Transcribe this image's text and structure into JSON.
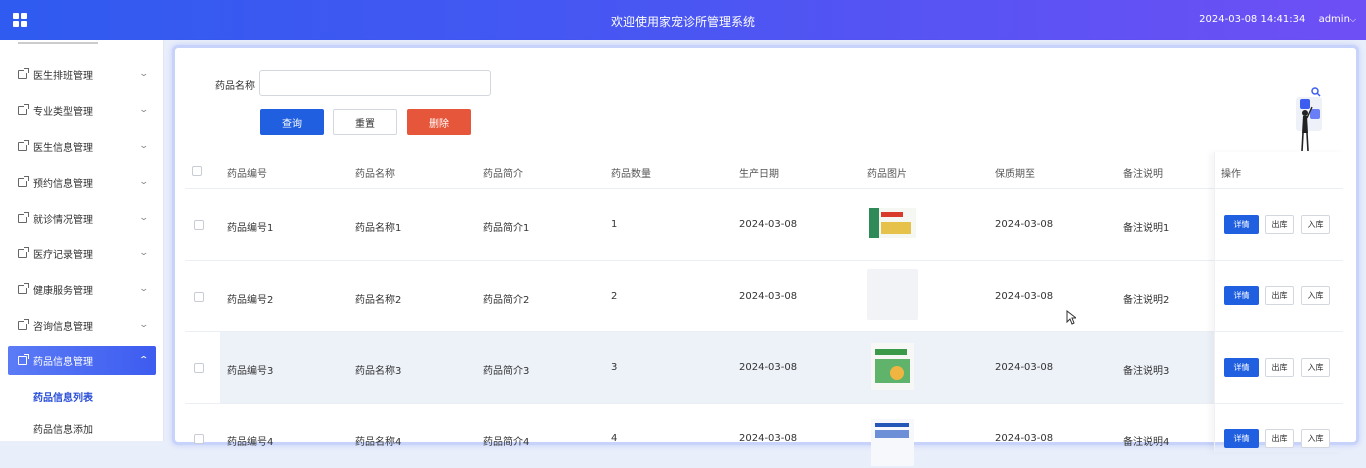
{
  "header": {
    "title": "欢迎使用家宠诊所管理系统",
    "datetime": "2024-03-08 14:41:34",
    "user": "admin",
    "user_caret": "⌵",
    "menu_icon": "grid-icon"
  },
  "sidebar": {
    "items": [
      {
        "label": "医生排班管理"
      },
      {
        "label": "专业类型管理"
      },
      {
        "label": "医生信息管理"
      },
      {
        "label": "预约信息管理"
      },
      {
        "label": "就诊情况管理"
      },
      {
        "label": "医疗记录管理"
      },
      {
        "label": "健康服务管理"
      },
      {
        "label": "咨询信息管理"
      },
      {
        "label": "药品信息管理"
      }
    ],
    "sub_items": [
      {
        "label": "药品信息列表"
      },
      {
        "label": "药品信息添加"
      }
    ]
  },
  "search": {
    "label": "药品名称",
    "value": "",
    "placeholder": ""
  },
  "buttons": {
    "query": "查询",
    "reset": "重置",
    "delete": "删除"
  },
  "table": {
    "columns": [
      "药品编号",
      "药品名称",
      "药品简介",
      "药品数量",
      "生产日期",
      "药品图片",
      "保质期至",
      "备注说明",
      "操作"
    ],
    "rows": [
      {
        "code": "药品编号1",
        "name": "药品名称1",
        "intro": "药品简介1",
        "qty": "1",
        "produced": "2024-03-08",
        "expires": "2024-03-08",
        "remark": "备注说明1"
      },
      {
        "code": "药品编号2",
        "name": "药品名称2",
        "intro": "药品简介2",
        "qty": "2",
        "produced": "2024-03-08",
        "expires": "2024-03-08",
        "remark": "备注说明2"
      },
      {
        "code": "药品编号3",
        "name": "药品名称3",
        "intro": "药品简介3",
        "qty": "3",
        "produced": "2024-03-08",
        "expires": "2024-03-08",
        "remark": "备注说明3"
      },
      {
        "code": "药品编号4",
        "name": "药品名称4",
        "intro": "药品简介4",
        "qty": "4",
        "produced": "2024-03-08",
        "expires": "2024-03-08",
        "remark": "备注说明4"
      }
    ],
    "actions": {
      "detail": "详情",
      "out": "出库",
      "in": "入库"
    }
  },
  "colors": {
    "primary": "#1f5fe0",
    "danger": "#e6563a",
    "header_start": "#2f5bf0",
    "header_end": "#6e4ff5"
  }
}
